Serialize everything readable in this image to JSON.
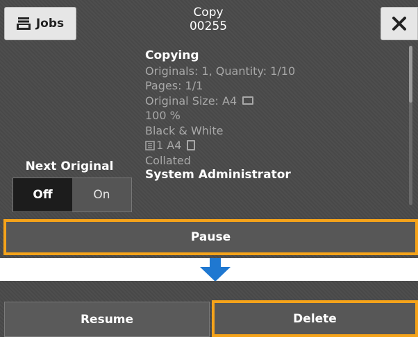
{
  "header": {
    "jobs_label": "Jobs",
    "title": "Copy",
    "job_number": "00255"
  },
  "details": {
    "status": "Copying",
    "originals_quantity": "Originals: 1, Quantity: 1/10",
    "pages": "Pages: 1/1",
    "original_size": "Original Size: A4",
    "zoom": "100 %",
    "color_mode": "Black & White",
    "tray_paper": "1 A4",
    "collation": "Collated",
    "owner": "System Administrator"
  },
  "next_original": {
    "label": "Next Original",
    "off_label": "Off",
    "on_label": "On",
    "selected": "Off"
  },
  "pause_label": "Pause",
  "resume_label": "Resume",
  "delete_label": "Delete",
  "colors": {
    "panel_bg": "#4a4a4a",
    "highlight": "#f5a31a",
    "arrow": "#1f78d1",
    "toggle_selected": "#1c1c1c"
  },
  "icons": {
    "jobs": "tray-stack-icon",
    "close": "close-icon",
    "size_orientation": "landscape-icon",
    "tray": "paper-tray-icon",
    "paper_orientation": "portrait-icon",
    "transition": "arrow-down-icon"
  }
}
